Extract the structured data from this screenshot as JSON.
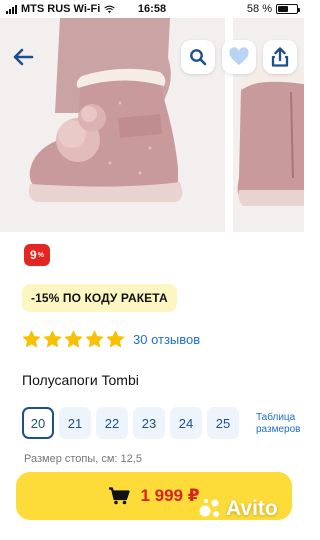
{
  "status_bar": {
    "carrier": "MTS RUS Wi-Fi",
    "time": "16:58",
    "battery_text": "58 %",
    "battery_level": 0.58
  },
  "header": {
    "icons": [
      "back-arrow-icon",
      "search-icon",
      "heart-icon",
      "share-icon"
    ],
    "accent_color": "#1d6fd6"
  },
  "gallery": {
    "visible_photos": 2
  },
  "badge": {
    "discount_text": "9",
    "discount_sup": "%",
    "color": "#e52521"
  },
  "promo": {
    "text": "-15% ПО КОДУ РАКЕТА",
    "background": "#fcf7c2"
  },
  "rating": {
    "stars": 5,
    "star_color": "#f7c100",
    "reviews_text": "30 отзывов"
  },
  "product": {
    "title": "Полусапоги Tombi"
  },
  "sizes": {
    "options": [
      "20",
      "21",
      "22",
      "23",
      "24",
      "25"
    ],
    "selected": "20",
    "table_link_line1": "Таблица",
    "table_link_line2": "размеров"
  },
  "foot_size": {
    "text": "Размер стопы, см: 12,5"
  },
  "buy": {
    "price": "1 999 ₽",
    "button_color": "#fddc3a",
    "price_color": "#d9231d"
  },
  "watermark": {
    "text": "Avito"
  }
}
